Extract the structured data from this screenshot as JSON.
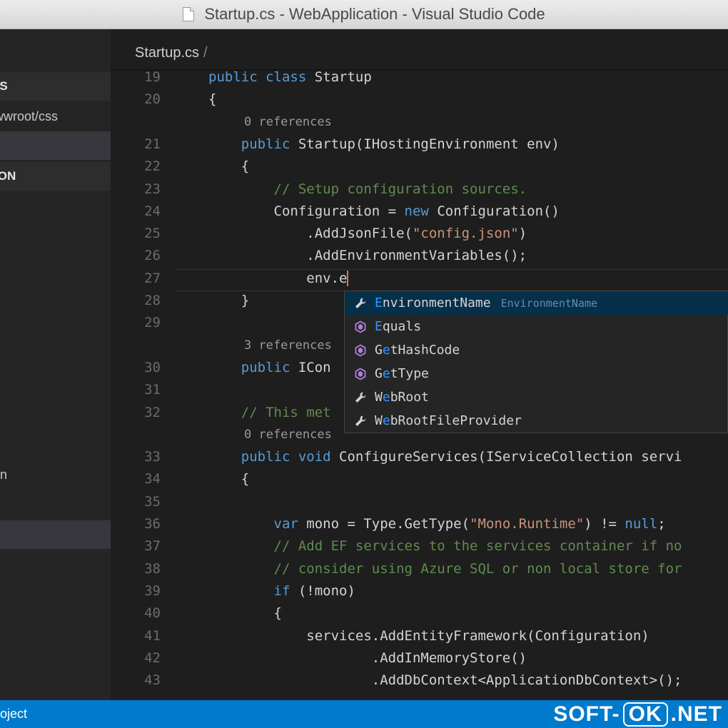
{
  "window": {
    "title": "Startup.cs - WebApplication - Visual Studio Code"
  },
  "sidebar": {
    "rows": [
      {
        "label": "ES",
        "type": "head"
      },
      {
        "label": "wwroot/css",
        "type": "item"
      },
      {
        "label": "",
        "type": "sel"
      },
      {
        "label": "ION",
        "type": "head"
      },
      {
        "label": "n",
        "type": "item"
      },
      {
        "label": "",
        "type": "sel"
      }
    ]
  },
  "editor": {
    "breadcrumb": {
      "file": "Startup.cs",
      "sep": "/"
    },
    "lines": [
      {
        "num": "19",
        "segs": [
          [
            "kw",
            "public class "
          ],
          [
            "",
            "Startup"
          ]
        ]
      },
      {
        "num": "20",
        "segs": [
          [
            "",
            "{"
          ]
        ]
      },
      {
        "refs": "0 references"
      },
      {
        "num": "21",
        "segs": [
          [
            "",
            "    "
          ],
          [
            "kw",
            "public "
          ],
          [
            "",
            "Startup(IHostingEnvironment env)"
          ]
        ]
      },
      {
        "num": "22",
        "segs": [
          [
            "",
            "    {"
          ]
        ]
      },
      {
        "num": "23",
        "segs": [
          [
            "",
            "        "
          ],
          [
            "cmt",
            "// Setup configuration sources."
          ]
        ]
      },
      {
        "num": "24",
        "segs": [
          [
            "",
            "        Configuration = "
          ],
          [
            "kw",
            "new "
          ],
          [
            "",
            "Configuration()"
          ]
        ]
      },
      {
        "num": "25",
        "segs": [
          [
            "",
            "            .AddJsonFile("
          ],
          [
            "str",
            "\"config.json\""
          ],
          [
            "",
            ")"
          ]
        ]
      },
      {
        "num": "26",
        "segs": [
          [
            "",
            "            .AddEnvironmentVariables();"
          ]
        ]
      },
      {
        "num": "27",
        "segs": [
          [
            "",
            "            env.e"
          ]
        ]
      },
      {
        "num": "28",
        "segs": [
          [
            "",
            "    }"
          ]
        ]
      },
      {
        "num": "29",
        "segs": []
      },
      {
        "refs": "3 references"
      },
      {
        "num": "30",
        "segs": [
          [
            "",
            "    "
          ],
          [
            "kw",
            "public "
          ],
          [
            "",
            "ICon"
          ]
        ]
      },
      {
        "num": "31",
        "segs": []
      },
      {
        "num": "32",
        "segs": [
          [
            "",
            "    "
          ],
          [
            "cmt",
            "// This met"
          ]
        ]
      },
      {
        "refs": "0 references"
      },
      {
        "num": "33",
        "segs": [
          [
            "",
            "    "
          ],
          [
            "kw",
            "public void "
          ],
          [
            "",
            "ConfigureServices(IServiceCollection servi"
          ]
        ]
      },
      {
        "num": "34",
        "segs": [
          [
            "",
            "    {"
          ]
        ]
      },
      {
        "num": "35",
        "segs": []
      },
      {
        "num": "36",
        "segs": [
          [
            "",
            "        "
          ],
          [
            "kw",
            "var "
          ],
          [
            "",
            "mono = Type.GetType("
          ],
          [
            "str",
            "\"Mono.Runtime\""
          ],
          [
            "",
            ") != "
          ],
          [
            "kw",
            "null"
          ],
          [
            "",
            ";"
          ]
        ]
      },
      {
        "num": "37",
        "segs": [
          [
            "",
            "        "
          ],
          [
            "cmt",
            "// Add EF services to the services container if no"
          ]
        ]
      },
      {
        "num": "38",
        "segs": [
          [
            "",
            "        "
          ],
          [
            "cmt",
            "// consider using Azure SQL or non local store for"
          ]
        ]
      },
      {
        "num": "39",
        "segs": [
          [
            "",
            "        "
          ],
          [
            "kw",
            "if "
          ],
          [
            "",
            "(!mono)"
          ]
        ]
      },
      {
        "num": "40",
        "segs": [
          [
            "",
            "        {"
          ]
        ]
      },
      {
        "num": "41",
        "segs": [
          [
            "",
            "            services.AddEntityFramework(Configuration)"
          ]
        ]
      },
      {
        "num": "42",
        "segs": [
          [
            "",
            "                    .AddInMemoryStore()"
          ]
        ]
      },
      {
        "num": "43",
        "segs": [
          [
            "",
            "                    .AddDbContext<ApplicationDbContext>();"
          ]
        ]
      }
    ]
  },
  "suggest": {
    "items": [
      {
        "match": "E",
        "rest": "nvironmentName",
        "detail": "EnvironmentName",
        "icon": "wrench-icon",
        "active": true
      },
      {
        "match": "E",
        "rest": "quals",
        "detail": "",
        "icon": "method-icon",
        "active": false
      },
      {
        "match": "",
        "rest": "GetHashCode",
        "hl": "e",
        "pre": "G",
        "post": "tHashCode",
        "detail": "",
        "icon": "method-icon",
        "active": false
      },
      {
        "match": "",
        "rest": "GetType",
        "hl": "e",
        "pre": "G",
        "post": "tType",
        "detail": "",
        "icon": "method-icon",
        "active": false
      },
      {
        "match": "",
        "rest": "WebRoot",
        "hl": "e",
        "pre": "W",
        "post": "bRoot",
        "detail": "",
        "icon": "wrench-icon",
        "active": false
      },
      {
        "match": "",
        "rest": "WebRootFileProvider",
        "hl": "e",
        "pre": "W",
        "post": "bRootFileProvider",
        "detail": "",
        "icon": "wrench-icon",
        "active": false
      }
    ]
  },
  "statusbar": {
    "left": "oject"
  },
  "watermark": {
    "a": "SOFT-",
    "b": "OK",
    "c": ".NET"
  },
  "colors": {
    "accent": "#007acc",
    "keyword": "#569cd6",
    "string": "#ce9178",
    "comment": "#608b4e"
  }
}
